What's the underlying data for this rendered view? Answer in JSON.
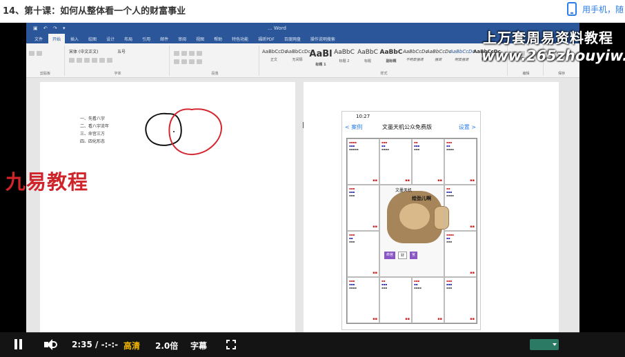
{
  "page": {
    "title": "14、第十课：如何从整体看一个人的财富事业",
    "phone_link": "用手机，随"
  },
  "word": {
    "doc_title": "... Word",
    "tabs": [
      {
        "label": "文件"
      },
      {
        "label": "开始",
        "active": true
      },
      {
        "label": "插入"
      },
      {
        "label": "绘图"
      },
      {
        "label": "设计"
      },
      {
        "label": "布局"
      },
      {
        "label": "引用"
      },
      {
        "label": "邮件"
      },
      {
        "label": "审阅"
      },
      {
        "label": "视图"
      },
      {
        "label": "帮助"
      },
      {
        "label": "特色功能"
      },
      {
        "label": "福昕PDF"
      },
      {
        "label": "百度网盘"
      },
      {
        "label": "操作说明搜索"
      }
    ],
    "ribbon": {
      "groups": [
        "剪贴板",
        "字体",
        "段落",
        "样式",
        "编辑",
        "保存"
      ],
      "font_name": "宋体 (中文正文)",
      "font_size": "五号",
      "styles": [
        {
          "preview": "AaBbCcDc",
          "label": "正文"
        },
        {
          "preview": "AaBbCcDc",
          "label": "无间隔"
        },
        {
          "preview": "AaBl",
          "label": "标题 1",
          "big": true
        },
        {
          "preview": "AaBbC",
          "label": "标题 2"
        },
        {
          "preview": "AaBbC",
          "label": "标题"
        },
        {
          "preview": "AaBbC",
          "label": "副标题"
        },
        {
          "preview": "AaBbCcDc",
          "label": "不明显强调"
        },
        {
          "preview": "AaBbCcDc",
          "label": "强调"
        },
        {
          "preview": "AaBbCcDc",
          "label": "明显强调"
        },
        {
          "preview": "AaBbCcDc",
          "label": "要点"
        }
      ]
    }
  },
  "document": {
    "outline": [
      "一、先看八宇",
      "二、看八宇流年",
      "三、命宫三方",
      "四、四化形态"
    ]
  },
  "watermarks": {
    "top": "上万套周易资料教程",
    "url": "www.265zhouyiw.",
    "left": "九易教程"
  },
  "phone": {
    "status_time": "10:27",
    "nav_back": "< 案例",
    "nav_title": "文墨天机公众免费版",
    "nav_settings": "设置 >",
    "meme_line1": "文墨天机",
    "meme_line2": "给劲儿啊",
    "badges": [
      "命宫",
      "财",
      "官"
    ]
  },
  "player": {
    "time": "2:35 / -:-:-",
    "quality": "高清",
    "speed": "2.0倍",
    "subtitles": "字幕"
  },
  "colors": {
    "word_blue": "#2b579a",
    "player_quality": "#f5b800",
    "watermark_red": "#d0242b",
    "link_blue": "#2b7de9"
  },
  "icons": [
    "phone-icon",
    "pause-icon",
    "volume-icon",
    "fullscreen-icon",
    "ibeam-cursor-icon"
  ]
}
